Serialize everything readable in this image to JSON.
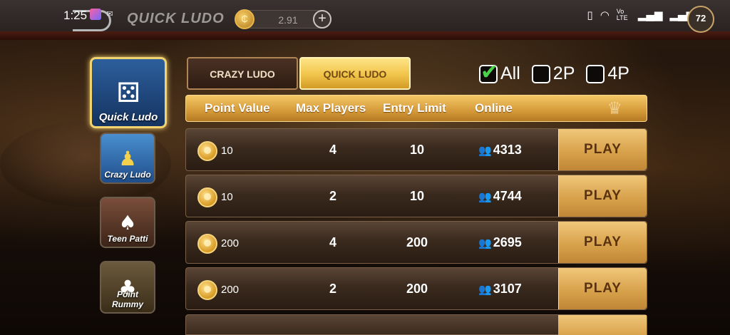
{
  "status_bar": {
    "time": "1:25",
    "battery": "72",
    "network": "Vo LTE"
  },
  "header": {
    "title": "QUICK LUDO",
    "balance": "2.91",
    "add_symbol": "+"
  },
  "games": [
    {
      "label": "Quick Ludo",
      "icon": "dice-icon",
      "active": true
    },
    {
      "label": "Crazy Ludo",
      "icon": "ludo-pawns-icon",
      "active": false
    },
    {
      "label": "Teen Patti",
      "icon": "playing-cards-icon",
      "active": false
    },
    {
      "label": "Point Rummy",
      "icon": "rummy-cards-icon",
      "active": false
    }
  ],
  "tabs": [
    {
      "label": "CRAZY LUDO",
      "active": false
    },
    {
      "label": "QUICK LUDO",
      "active": true
    }
  ],
  "filters": [
    {
      "label": "All",
      "checked": true
    },
    {
      "label": "2P",
      "checked": false
    },
    {
      "label": "4P",
      "checked": false
    }
  ],
  "table": {
    "headers": [
      "Point Value",
      "Max Players",
      "Entry Limit",
      "Online"
    ],
    "play_label": "PLAY",
    "rows": [
      {
        "point_value": "10",
        "max_players": "4",
        "entry_limit": "10",
        "online": "4313"
      },
      {
        "point_value": "10",
        "max_players": "2",
        "entry_limit": "10",
        "online": "4744"
      },
      {
        "point_value": "200",
        "max_players": "4",
        "entry_limit": "200",
        "online": "2695"
      },
      {
        "point_value": "200",
        "max_players": "2",
        "entry_limit": "200",
        "online": "3107"
      }
    ]
  },
  "colors": {
    "gold": "#f1c44a",
    "check_green": "#4cd14a",
    "bg_dark": "#120b06"
  }
}
